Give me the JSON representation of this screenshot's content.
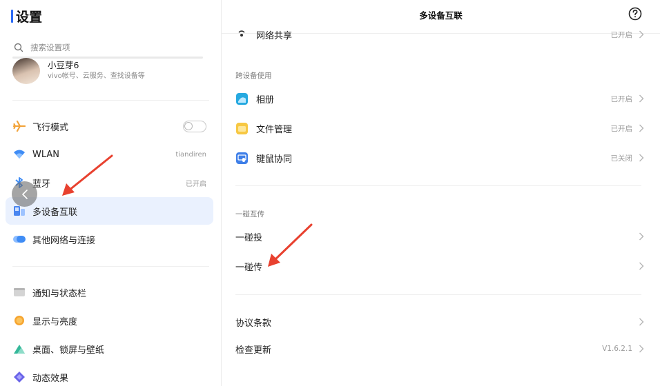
{
  "sidebar": {
    "title": "设置",
    "search_placeholder": "搜索设置项",
    "account": {
      "name": "小豆芽6",
      "subtitle": "vivo帐号、云服务、查找设备等"
    },
    "items": [
      {
        "label": "飞行模式",
        "value": "",
        "icon": "airplane-icon"
      },
      {
        "label": "WLAN",
        "value": "tiandiren",
        "icon": "wifi-icon"
      },
      {
        "label": "蓝牙",
        "value": "已开启",
        "icon": "bluetooth-icon"
      },
      {
        "label": "多设备互联",
        "value": "",
        "icon": "multi-device-icon"
      },
      {
        "label": "其他网络与连接",
        "value": "",
        "icon": "network-icon"
      },
      {
        "label": "通知与状态栏",
        "value": "",
        "icon": "notification-icon"
      },
      {
        "label": "显示与亮度",
        "value": "",
        "icon": "display-icon"
      },
      {
        "label": "桌面、锁屏与壁纸",
        "value": "",
        "icon": "wallpaper-icon"
      },
      {
        "label": "动态效果",
        "value": "",
        "icon": "motion-icon"
      }
    ]
  },
  "main": {
    "title": "多设备互联",
    "top_row": {
      "label": "网络共享",
      "value": "已开启"
    },
    "section_cross": "跨设备使用",
    "cross_rows": [
      {
        "label": "相册",
        "value": "已开启"
      },
      {
        "label": "文件管理",
        "value": "已开启"
      },
      {
        "label": "键鼠协同",
        "value": "已关闭"
      }
    ],
    "section_tap": "一碰互传",
    "tap_rows": [
      {
        "label": "一碰投",
        "value": ""
      },
      {
        "label": "一碰传",
        "value": ""
      }
    ],
    "bottom_rows": [
      {
        "label": "协议条款",
        "value": ""
      },
      {
        "label": "检查更新",
        "value": "V1.6.2.1"
      }
    ]
  },
  "colors": {
    "accent": "#2d6cf6",
    "active_bg": "#eaf1fe",
    "annotation_arrow": "#e8412f"
  }
}
